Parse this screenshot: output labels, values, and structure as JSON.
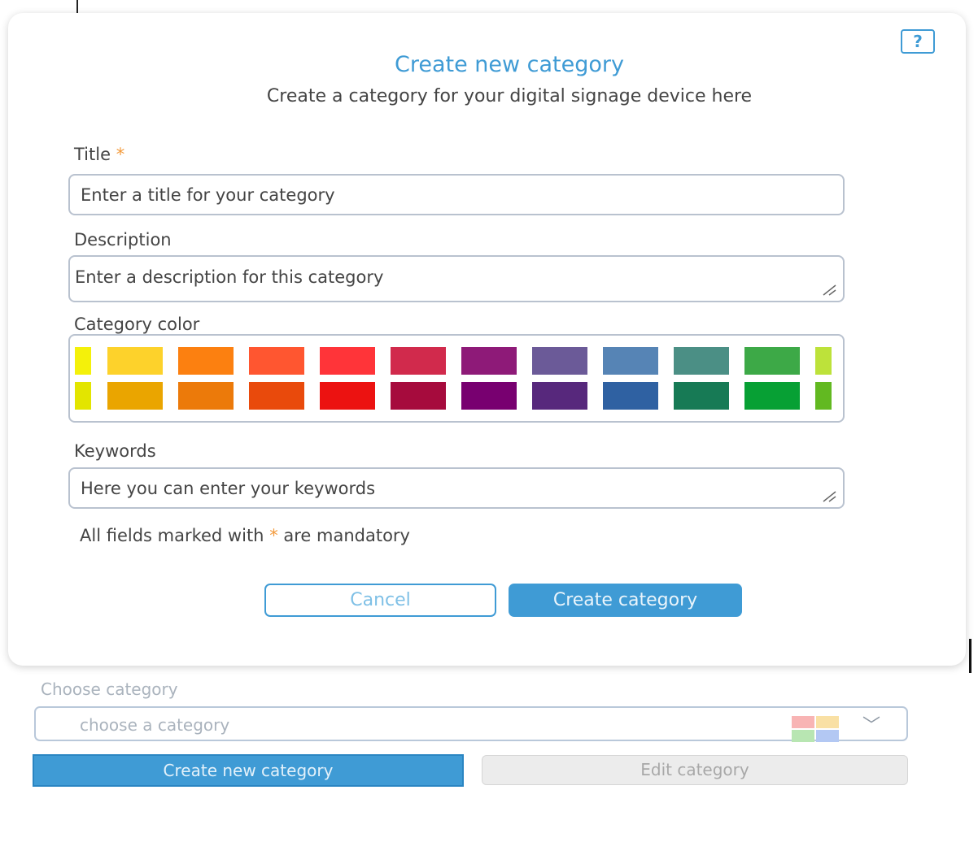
{
  "modal": {
    "help_label": "?",
    "title": "Create new category",
    "subtitle": "Create a category for your digital signage device here",
    "title_field": {
      "label": "Title",
      "required_mark": "*",
      "placeholder": "Enter a title for your category"
    },
    "description_field": {
      "label": "Description",
      "placeholder": "Enter a description for this category"
    },
    "color_field": {
      "label": "Category color",
      "row1": [
        "#f4f10a",
        "#fdd22b",
        "#fc8010",
        "#ff5630",
        "#ff3439",
        "#d12a4c",
        "#8e1a78",
        "#6b5a98",
        "#5684b5",
        "#4b8f85",
        "#3da947",
        "#bde23a"
      ],
      "row2": [
        "#e3e500",
        "#eaa500",
        "#ec7a0a",
        "#e94a0c",
        "#ec1211",
        "#a60b3d",
        "#780070",
        "#57287c",
        "#2f61a2",
        "#177a55",
        "#07a034",
        "#62b921"
      ]
    },
    "keywords_field": {
      "label": "Keywords",
      "placeholder": "Here you can enter your keywords"
    },
    "mandatory_note_prefix": "All fields marked with",
    "mandatory_note_mark": "*",
    "mandatory_note_suffix": "are mandatory",
    "cancel_label": "Cancel",
    "create_label": "Create category"
  },
  "category_picker": {
    "label": "Choose category",
    "placeholder": "choose a category",
    "icon_colors": [
      "#f8b4b4",
      "#f9e0a4",
      "#b8e6b2",
      "#b3c8f3"
    ],
    "new_button": "Create new category",
    "edit_button": "Edit category"
  },
  "colors": {
    "accent": "#3f9bd5",
    "required": "#f39a3c"
  }
}
